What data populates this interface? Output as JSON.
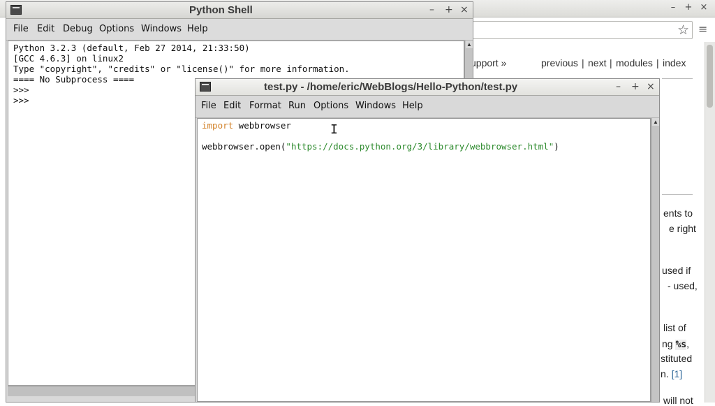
{
  "browser": {
    "nav": {
      "support": "upport »",
      "previous": "previous",
      "next": "next",
      "modules": "modules",
      "index": "index",
      "separator": "|"
    },
    "fragments": [
      "ents to",
      "e right",
      "used if",
      "- used,",
      "list of",
      "ng",
      "stituted",
      "n.",
      "will not"
    ],
    "code_fragment": "%s",
    "footnote_link": "[1]",
    "star_icon": "star-icon",
    "menu_icon": "hamburger-menu-icon"
  },
  "shell": {
    "title": "Python Shell",
    "menu": [
      "File",
      "Edit",
      "Debug",
      "Options",
      "Windows",
      "Help"
    ],
    "lines": [
      "Python 3.2.3 (default, Feb 27 2014, 21:33:50)",
      "[GCC 4.6.3] on linux2",
      "Type \"copyright\", \"credits\" or \"license()\" for more information.",
      "==== No Subprocess ====",
      ">>>",
      ">>>"
    ]
  },
  "editor": {
    "title": "test.py - /home/eric/WebBlogs/Hello-Python/test.py",
    "menu": [
      "File",
      "Edit",
      "Format",
      "Run",
      "Options",
      "Windows",
      "Help"
    ],
    "code": {
      "line1_kw": "import",
      "line1_rest": " webbrowser",
      "line3_pre": "webbrowser.open(",
      "line3_str": "\"https://docs.python.org/3/library/webbrowser.html\"",
      "line3_post": ")"
    }
  },
  "window_controls": {
    "minimize": "–",
    "maximize": "+",
    "close": "×"
  },
  "colors": {
    "keyword": "#d2822a",
    "string": "#2d8a2d",
    "link": "#2a6496"
  }
}
